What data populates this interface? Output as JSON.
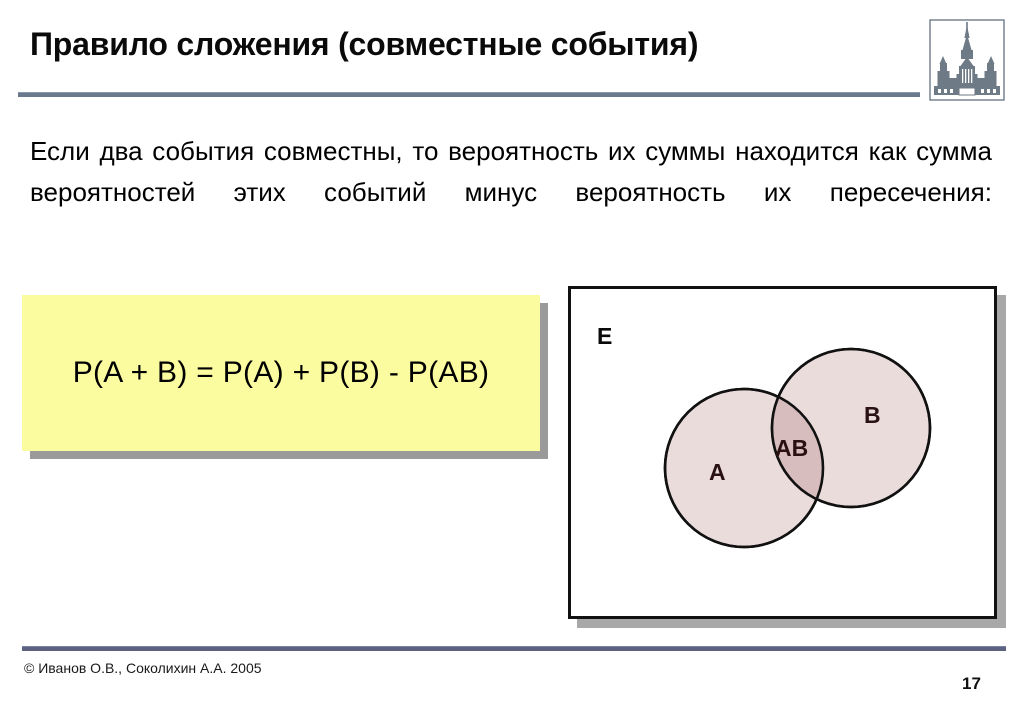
{
  "slide": {
    "title": "Правило сложения (совместные события)",
    "body": "Если два события совместны, то вероятность их суммы находится как сумма вероятностей этих событий минус вероятность их пересечения:",
    "page_number": "17"
  },
  "logo": {
    "name": "msu-main-building-logo",
    "alt": "Главное здание МГУ"
  },
  "formula": {
    "text": "P(A + B) = P(A) + P(B) - P(AB)",
    "background_color": "#fbfba0",
    "shadow_color": "#9a9a9a"
  },
  "venn": {
    "universe_label": "E",
    "set_a_label": "A",
    "set_b_label": "B",
    "intersection_label": "AB",
    "circle_fill": "#ebdcdc",
    "intersection_fill": "#d7bdbd",
    "stroke_color": "#111111",
    "frame_color": "#111111",
    "shadow_color": "#a8a8a8"
  },
  "footer": {
    "credit": "© Иванов О.В., Соколихин А.А. 2005",
    "rule_color": "#5c6180"
  },
  "theme": {
    "title_rule_color": "#6a7a8c",
    "background": "#ffffff",
    "text_color": "#000000"
  }
}
